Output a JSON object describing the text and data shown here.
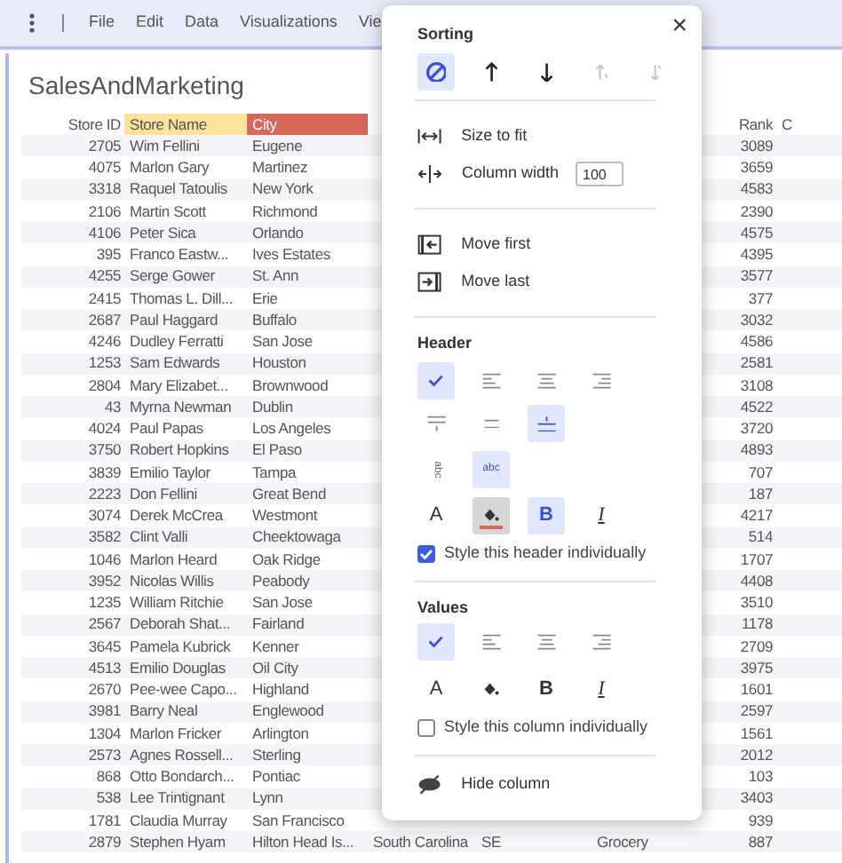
{
  "menu": {
    "items": [
      "File",
      "Edit",
      "Data",
      "Visualizations",
      "Vie"
    ]
  },
  "title": "SalesAndMarketing",
  "table": {
    "columns": [
      {
        "label": "Store ID"
      },
      {
        "label": "Store Name",
        "color": "#fbe39b"
      },
      {
        "label": "City",
        "color": "#d5675b"
      },
      {
        "label": "Rank"
      },
      {
        "label": "C"
      }
    ],
    "rows": [
      {
        "store_id": "2705",
        "store_name": "Wim Fellini",
        "city": "Eugene",
        "rank": "3089"
      },
      {
        "store_id": "4075",
        "store_name": "Marlon Gary",
        "city": "Martinez",
        "rank": "3659"
      },
      {
        "store_id": "3318",
        "store_name": "Raquel Tatoulis",
        "city": "New York",
        "rank": "4583"
      },
      {
        "store_id": "2106",
        "store_name": "Martin Scott",
        "city": "Richmond",
        "rank": "2390"
      },
      {
        "store_id": "4106",
        "store_name": "Peter Sica",
        "city": "Orlando",
        "rank": "4575"
      },
      {
        "store_id": "395",
        "store_name": "Franco Eastw...",
        "city": "Ives Estates",
        "rank": "4395"
      },
      {
        "store_id": "4255",
        "store_name": "Serge Gower",
        "city": "St. Ann",
        "rank": "3577"
      },
      {
        "store_id": "2415",
        "store_name": "Thomas L. Dill...",
        "city": "Erie",
        "rank": "377"
      },
      {
        "store_id": "2687",
        "store_name": "Paul Haggard",
        "city": "Buffalo",
        "rank": "3032"
      },
      {
        "store_id": "4246",
        "store_name": "Dudley Ferratti",
        "city": "San Jose",
        "rank": "4586"
      },
      {
        "store_id": "1253",
        "store_name": "Sam Edwards",
        "city": "Houston",
        "rank": "2581"
      },
      {
        "store_id": "2804",
        "store_name": "Mary Elizabet...",
        "city": "Brownwood",
        "rank": "3108"
      },
      {
        "store_id": "43",
        "store_name": "Myrna Newman",
        "city": "Dublin",
        "rank": "4522"
      },
      {
        "store_id": "4024",
        "store_name": "Paul Papas",
        "city": "Los Angeles",
        "rank": "3720"
      },
      {
        "store_id": "3750",
        "store_name": "Robert Hopkins",
        "city": "El Paso",
        "rank": "4893"
      },
      {
        "store_id": "3839",
        "store_name": "Emilio Taylor",
        "city": "Tampa",
        "rank": "707"
      },
      {
        "store_id": "2223",
        "store_name": "Don Fellini",
        "city": "Great Bend",
        "rank": "187"
      },
      {
        "store_id": "3074",
        "store_name": "Derek McCrea",
        "city": "Westmont",
        "rank": "4217"
      },
      {
        "store_id": "3582",
        "store_name": "Clint Valli",
        "city": "Cheektowaga",
        "rank": "514"
      },
      {
        "store_id": "1046",
        "store_name": "Marlon Heard",
        "city": "Oak Ridge",
        "rank": "1707"
      },
      {
        "store_id": "3952",
        "store_name": "Nicolas Willis",
        "city": "Peabody",
        "rank": "4408"
      },
      {
        "store_id": "1235",
        "store_name": "William Ritchie",
        "city": "San Jose",
        "rank": "3510"
      },
      {
        "store_id": "2567",
        "store_name": "Deborah Shat...",
        "city": "Fairland",
        "rank": "1178"
      },
      {
        "store_id": "3645",
        "store_name": "Pamela Kubrick",
        "city": "Kenner",
        "rank": "2709"
      },
      {
        "store_id": "4513",
        "store_name": "Emilio Douglas",
        "city": "Oil City",
        "rank": "3975"
      },
      {
        "store_id": "2670",
        "store_name": "Pee-wee Capo...",
        "city": "Highland",
        "rank": "1601"
      },
      {
        "store_id": "3981",
        "store_name": "Barry Neal",
        "city": "Englewood",
        "rank": "2597"
      },
      {
        "store_id": "1304",
        "store_name": "Marlon Fricker",
        "city": "Arlington",
        "rank": "1561"
      },
      {
        "store_id": "2573",
        "store_name": "Agnes Rossell...",
        "city": "Sterling",
        "rank": "2012"
      },
      {
        "store_id": "868",
        "store_name": "Otto Bondarch...",
        "city": "Pontiac",
        "rank": "103"
      },
      {
        "store_id": "538",
        "store_name": "Lee Trintignant",
        "city": "Lynn",
        "rank": "3403"
      },
      {
        "store_id": "1781",
        "store_name": "Claudia Murray",
        "city": "San Francisco",
        "rank": "939"
      },
      {
        "store_id": "2879",
        "store_name": "Stephen Hyam",
        "city": "Hilton Head Is...",
        "column_4": "South Carolina",
        "column_5": "SE",
        "column_6": "Grocery",
        "rank": "887"
      }
    ]
  },
  "popup": {
    "close": "×",
    "sorting": {
      "label": "Sorting",
      "options": [
        {
          "kind": "none",
          "selected": true,
          "disabled": false
        },
        {
          "kind": "ascending",
          "selected": false,
          "disabled": false
        },
        {
          "kind": "descending",
          "selected": false,
          "disabled": false
        },
        {
          "kind": "ascending_alt",
          "selected": false,
          "disabled": true
        },
        {
          "kind": "descending_alt",
          "selected": false,
          "disabled": true
        }
      ]
    },
    "size_to_fit": "Size to fit",
    "column_width": {
      "label": "Column width",
      "value": "100"
    },
    "move_first": "Move first",
    "move_last": "Move last",
    "header": {
      "label": "Header",
      "alignment": [
        {
          "kind": "auto",
          "selected": true
        },
        {
          "kind": "left",
          "selected": false
        },
        {
          "kind": "center",
          "selected": false
        },
        {
          "kind": "right",
          "selected": false
        }
      ],
      "vertical": [
        {
          "kind": "top",
          "selected": false
        },
        {
          "kind": "middle",
          "selected": false
        },
        {
          "kind": "bottom",
          "selected": true
        }
      ],
      "wrap": [
        {
          "kind": "rotated",
          "label": "abc",
          "selected": false
        },
        {
          "kind": "horizontal",
          "label": "abc",
          "selected": true
        }
      ],
      "style": [
        {
          "kind": "color",
          "label": "A",
          "selected": false
        },
        {
          "kind": "fill",
          "color": "#d5675b",
          "selected": true
        },
        {
          "kind": "bold",
          "label": "B",
          "selected": true
        },
        {
          "kind": "italic",
          "label": "I",
          "selected": false
        }
      ],
      "checkbox": {
        "label": "Style this header individually",
        "checked": true
      }
    },
    "values": {
      "label": "Values",
      "alignment": [
        {
          "kind": "auto",
          "selected": true
        },
        {
          "kind": "left",
          "selected": false
        },
        {
          "kind": "center",
          "selected": false
        },
        {
          "kind": "right",
          "selected": false
        }
      ],
      "style": [
        {
          "kind": "color",
          "label": "A",
          "selected": false
        },
        {
          "kind": "fill",
          "selected": false
        },
        {
          "kind": "bold",
          "label": "B",
          "selected": false
        },
        {
          "kind": "italic",
          "label": "I",
          "selected": false
        }
      ],
      "checkbox": {
        "label": "Style this column individually",
        "checked": false
      }
    },
    "hide_column": "Hide column"
  }
}
